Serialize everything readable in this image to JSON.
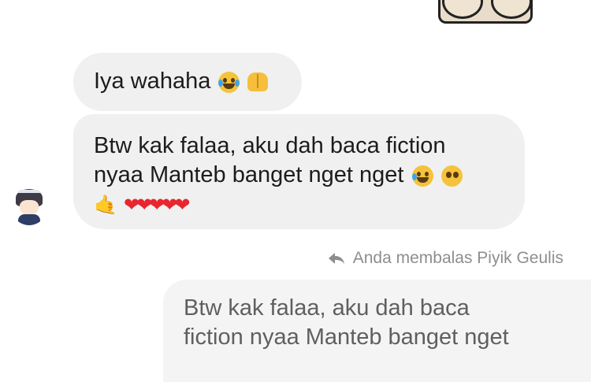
{
  "thread": {
    "messages": [
      {
        "sender": "incoming",
        "text": "Iya wahaha",
        "emoji": [
          "laughing-crying-emoji",
          "raised-hands-emoji"
        ]
      },
      {
        "sender": "incoming",
        "lines": [
          "Btw kak falaa, aku dah baca fiction",
          "nyaa Manteb banget nget nget"
        ],
        "emoji": [
          "grinning-tear-emoji",
          "pleading-face-emoji",
          "call-me-hand-emoji",
          "heart-emojis"
        ]
      }
    ],
    "reply_notice": "Anda membalas Piyik Geulis",
    "quoted_reply": {
      "lines": [
        "Btw kak falaa, aku dah baca",
        "fiction nyaa Manteb banget nget"
      ]
    }
  },
  "colors": {
    "incoming_bubble": "#f0f0f0",
    "quoted_bubble": "#f4f4f4",
    "notice_text": "#8e8e8e"
  }
}
